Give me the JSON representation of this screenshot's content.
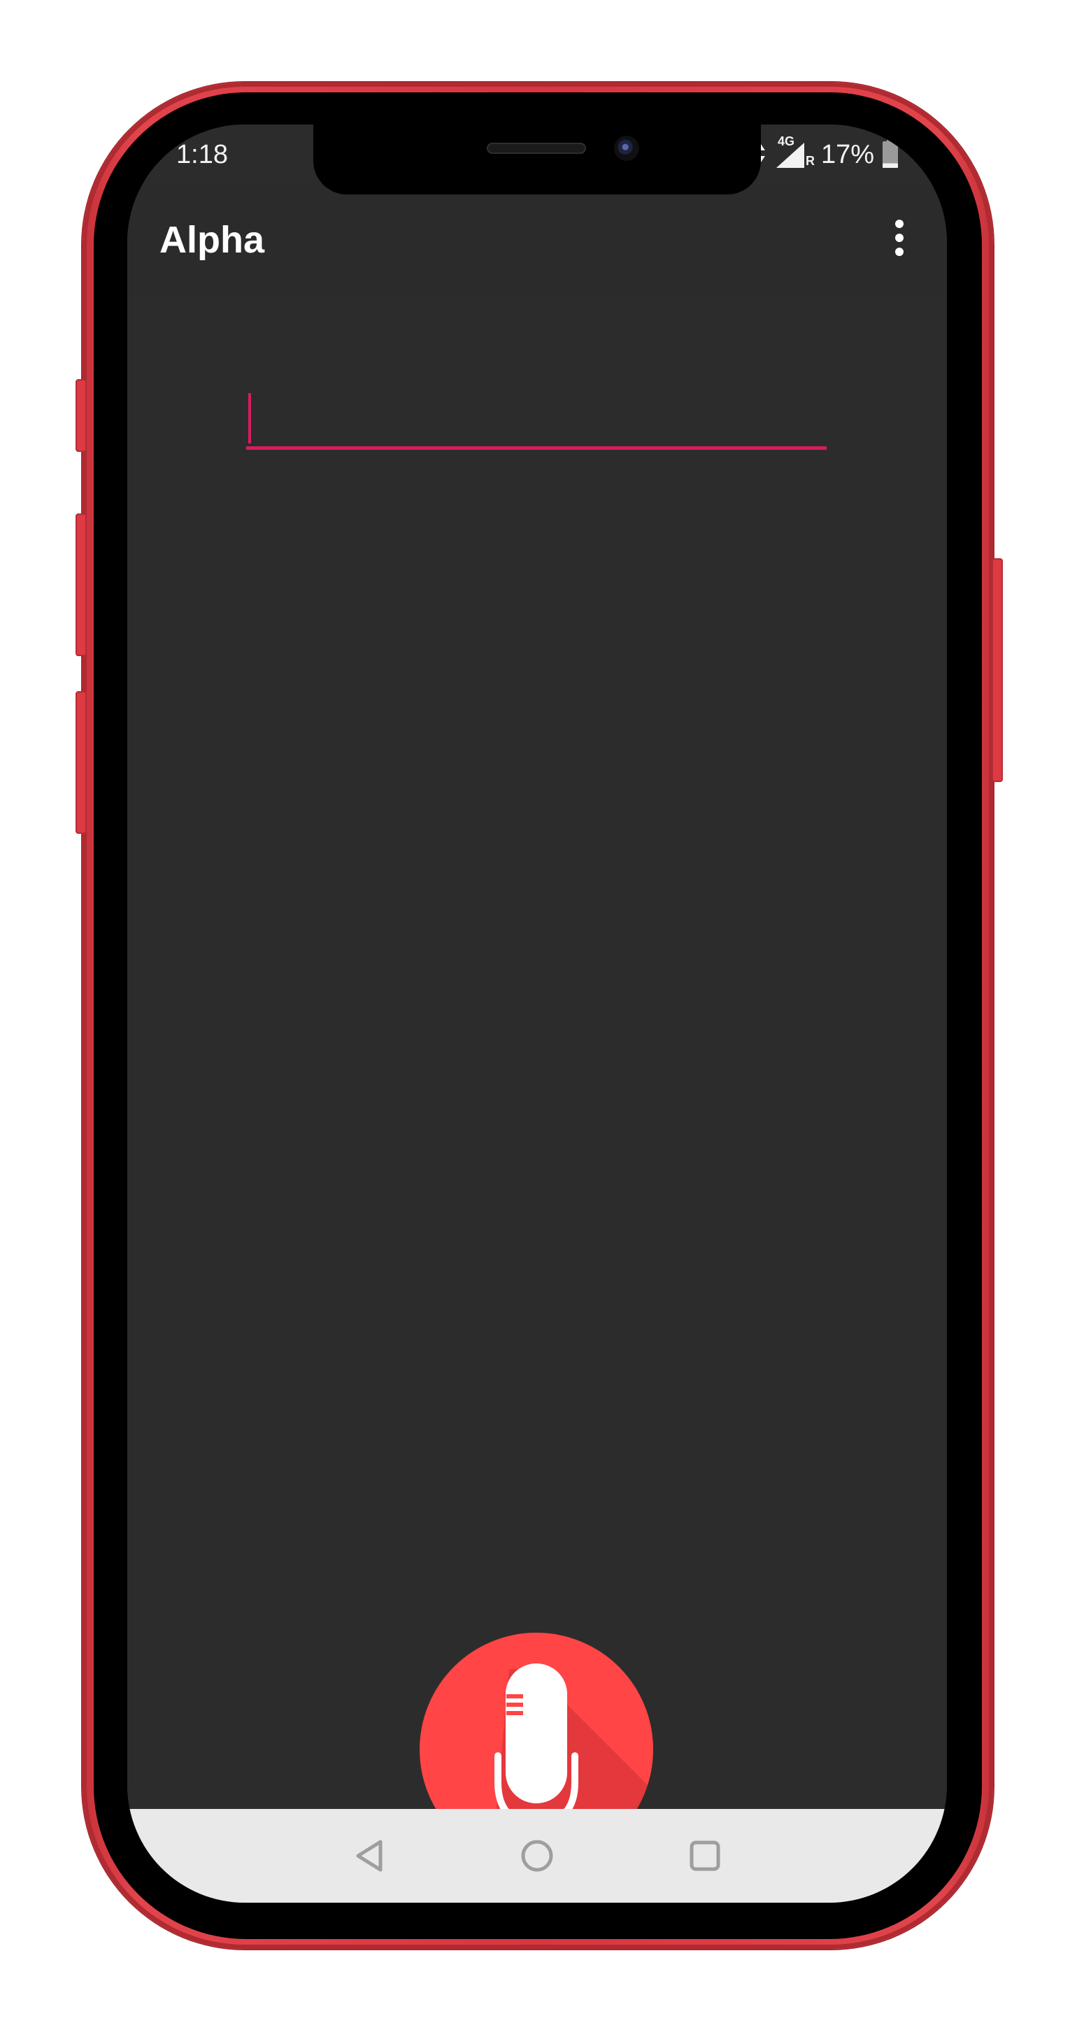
{
  "device": {
    "frame_color": "#d9363f"
  },
  "status_bar": {
    "time": "1:18",
    "network": "4G",
    "roaming": "R",
    "battery_percent": "17%",
    "battery_level": 0.17
  },
  "app_bar": {
    "title": "Alpha",
    "overflow_icon": "more-vert-icon"
  },
  "input": {
    "value": "",
    "focused": true,
    "accent_color": "#d81b60"
  },
  "mic": {
    "icon": "microphone-icon",
    "color": "#ff4545"
  },
  "nav": {
    "back_icon": "back-triangle-icon",
    "home_icon": "home-circle-icon",
    "recents_icon": "recents-square-icon"
  }
}
